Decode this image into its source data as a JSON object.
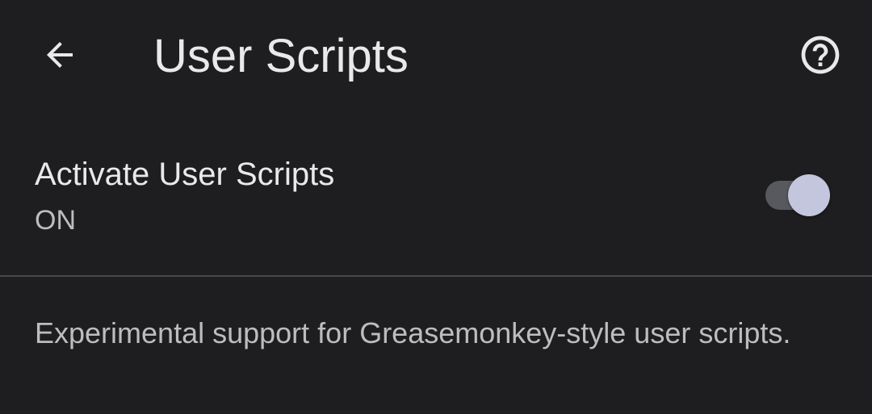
{
  "header": {
    "title": "User Scripts",
    "back_icon": "arrow-back-icon",
    "help_icon": "help-circle-icon"
  },
  "setting": {
    "title": "Activate User Scripts",
    "summary": "ON",
    "enabled": true
  },
  "footer": {
    "description": "Experimental support for Greasemonkey-style user scripts."
  },
  "colors": {
    "background": "#1e1e20",
    "primary_text": "#e9e9ea",
    "secondary_text": "#bdbdc0",
    "divider": "#49494d",
    "toggle_track": "#58595e",
    "toggle_thumb": "#c4c6de"
  }
}
